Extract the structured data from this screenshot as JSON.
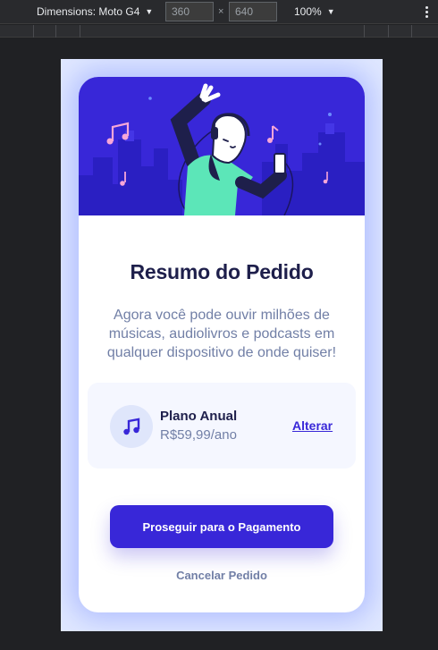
{
  "devtools": {
    "device": "Dimensions: Moto G4",
    "width": "360",
    "height": "640",
    "times": "×",
    "zoom": "100%"
  },
  "page": {
    "title": "Resumo do Pedido",
    "description": "Agora você pode ouvir milhões de músicas, audiolivros e podcasts em qualquer dispositivo de onde quiser!",
    "plan": {
      "name": "Plano Anual",
      "price": "R$59,99/ano",
      "change_label": "Alterar"
    },
    "pay_button": "Proseguir para o Pagamento",
    "cancel_label": "Cancelar Pedido"
  },
  "colors": {
    "primary": "#3827d8",
    "heading": "#1e1f4b",
    "muted": "#717fa6",
    "background": "#e0e8ff",
    "plan_box": "#f5f7ff",
    "illustration_accent": "#5ce6b8",
    "note_pink": "#f7a6d8"
  },
  "icons": {
    "hero": "hero-illustration",
    "plan": "music-note-icon",
    "device_caret": "caret-down-icon",
    "menu": "more-vertical-icon"
  }
}
